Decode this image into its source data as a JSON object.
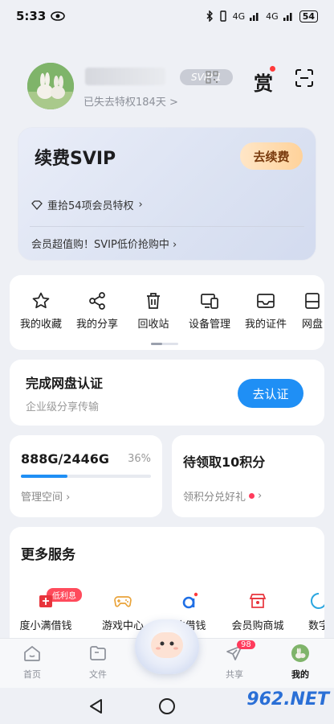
{
  "status_bar": {
    "time": "5:33",
    "network_1": "4G",
    "network_2": "4G",
    "battery": "54"
  },
  "profile": {
    "svip_badge": "SVIP 1",
    "lost_privilege": "已失去特权184天 >",
    "reward_icon_label": "赏"
  },
  "svip_card": {
    "title": "续费SVIP",
    "renew_button": "去续费",
    "privilege_text": "重拾54项会员特权",
    "promo_text": "会员超值购！SVIP低价抢购中"
  },
  "tools": [
    {
      "label": "我的收藏",
      "icon": "star-icon"
    },
    {
      "label": "我的分享",
      "icon": "share-icon"
    },
    {
      "label": "回收站",
      "icon": "trash-icon"
    },
    {
      "label": "设备管理",
      "icon": "devices-icon"
    },
    {
      "label": "我的证件",
      "icon": "id-card-icon"
    },
    {
      "label": "网盘",
      "icon": "disk-icon"
    }
  ],
  "auth_card": {
    "title": "完成网盘认证",
    "subtitle": "企业级分享传输",
    "button": "去认证"
  },
  "storage_card": {
    "usage": "888G/2446G",
    "percent_label": "36%",
    "percent": 36,
    "link": "管理空间"
  },
  "points_card": {
    "title": "待领取10积分",
    "link": "领积分兑好礼"
  },
  "services": {
    "title": "更多服务",
    "tag": "低利息",
    "items": [
      {
        "label": "度小满借钱",
        "icon": "wallet-icon"
      },
      {
        "label": "游戏中心",
        "icon": "gamepad-icon"
      },
      {
        "label": "信借钱",
        "icon": "loan-icon"
      },
      {
        "label": "会员购商城",
        "icon": "shop-icon"
      },
      {
        "label": "数字",
        "icon": "digital-icon"
      }
    ]
  },
  "tabbar": {
    "tabs": [
      {
        "label": "首页",
        "icon": "home-icon"
      },
      {
        "label": "文件",
        "icon": "folder-icon"
      },
      {
        "label": "共享",
        "icon": "send-icon",
        "badge": "98"
      },
      {
        "label": "我的",
        "icon": "avatar-icon"
      }
    ]
  },
  "watermark": "962.NET"
}
